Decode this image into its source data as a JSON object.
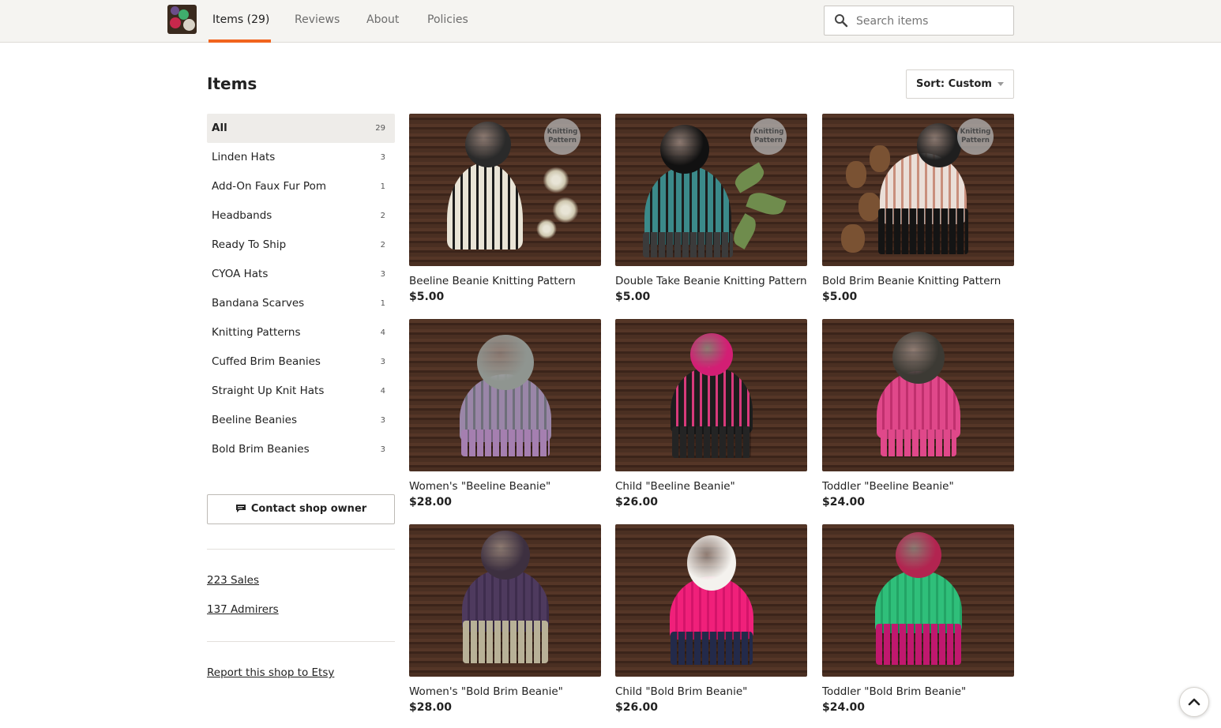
{
  "nav": {
    "tabs": [
      {
        "label": "Items (29)",
        "active": true
      },
      {
        "label": "Reviews"
      },
      {
        "label": "About"
      },
      {
        "label": "Policies"
      }
    ],
    "search_placeholder": "Search items",
    "accent_color": "#f1641e"
  },
  "main": {
    "heading": "Items",
    "sort_label": "Sort: Custom"
  },
  "sidebar": {
    "categories": [
      {
        "label": "All",
        "count": "29",
        "active": true
      },
      {
        "label": "Linden Hats",
        "count": "3"
      },
      {
        "label": "Add-On Faux Fur Pom",
        "count": "1"
      },
      {
        "label": "Headbands",
        "count": "2"
      },
      {
        "label": "Ready To Ship",
        "count": "2"
      },
      {
        "label": "CYOA Hats",
        "count": "3"
      },
      {
        "label": "Bandana Scarves",
        "count": "1"
      },
      {
        "label": "Knitting Patterns",
        "count": "4"
      },
      {
        "label": "Cuffed Brim Beanies",
        "count": "3"
      },
      {
        "label": "Straight Up Knit Hats",
        "count": "4"
      },
      {
        "label": "Beeline Beanies",
        "count": "3"
      },
      {
        "label": "Bold Brim Beanies",
        "count": "3"
      }
    ],
    "contact_label": "Contact shop owner",
    "sales_label": "223 Sales",
    "admirers_label": "137 Admirers",
    "report_label": "Report this shop to Etsy"
  },
  "products": [
    {
      "title": "Beeline Beanie Knitting Pattern",
      "price": "$5.00",
      "badge": "Knitting Pattern",
      "hat_color": "#e9e4d6",
      "stripe_color": "#1c1c1c",
      "brim_color": "#e9e4d6",
      "pom_color": "#2a2a2a"
    },
    {
      "title": "Double Take Beanie Knitting Pattern",
      "price": "$5.00",
      "badge": "Knitting Pattern",
      "hat_color": "#3b8a8a",
      "stripe_color": "#1c1c1c",
      "brim_color": "#3b3b3b",
      "pom_color": "#111111"
    },
    {
      "title": "Bold Brim Beanie Knitting Pattern",
      "price": "$5.00",
      "badge": "Knitting Pattern",
      "hat_color": "#eadfd8",
      "stripe_color": "#c98f7c",
      "brim_color": "#141414",
      "pom_color": "#1f1f1f"
    },
    {
      "title": "Women's \"Beeline Beanie\"",
      "price": "$28.00",
      "hat_color": "#9a86a8",
      "stripe_color": "#6e6f7a",
      "brim_color": "#a57fb0",
      "pom_color": "#8f9590"
    },
    {
      "title": "Child \"Beeline Beanie\"",
      "price": "$26.00",
      "hat_color": "#1d1d1d",
      "stripe_color": "#d83a7b",
      "brim_color": "#242424",
      "pom_color": "#d31e74"
    },
    {
      "title": "Toddler \"Beeline Beanie\"",
      "price": "$24.00",
      "hat_color": "#e0488a",
      "stripe_color": "#c0306e",
      "brim_color": "#e0488a",
      "pom_color": "#3c3a34"
    },
    {
      "title": "Women's \"Bold Brim Beanie\"",
      "price": "$28.00",
      "hat_color": "#4e3a5e",
      "stripe_color": "#3e2d4d",
      "brim_color": "#b8b197",
      "pom_color": "#3d3040"
    },
    {
      "title": "Child \"Bold Brim Beanie\"",
      "price": "$26.00",
      "hat_color": "#f0207a",
      "stripe_color": "#d4146a",
      "brim_color": "#232a4a",
      "pom_color": "#f4f2ee"
    },
    {
      "title": "Toddler \"Bold Brim Beanie\"",
      "price": "$24.00",
      "hat_color": "#2fbf7a",
      "stripe_color": "#23a466",
      "brim_color": "#c0186e",
      "pom_color": "#b22450"
    }
  ]
}
